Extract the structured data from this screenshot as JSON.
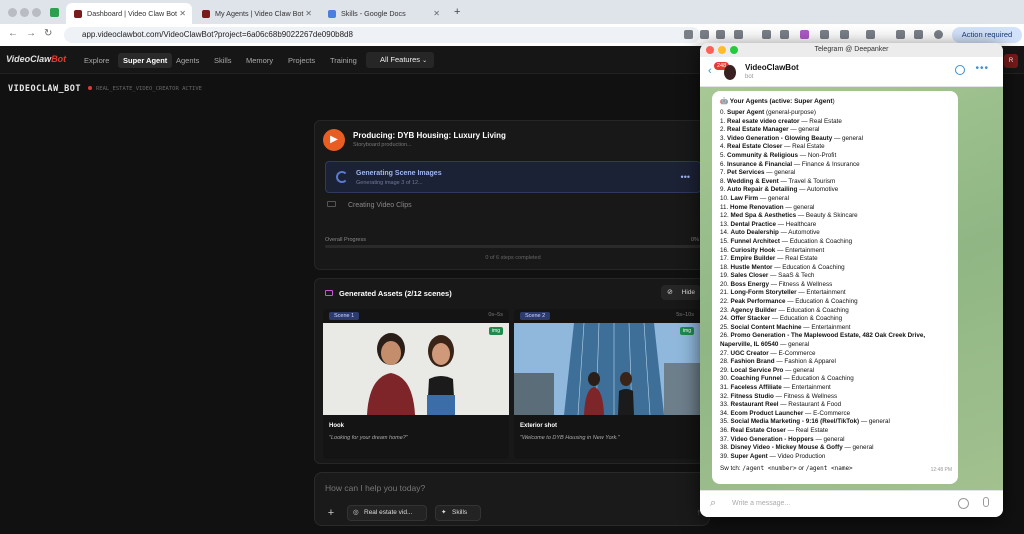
{
  "browser": {
    "tabs": [
      {
        "label": "Dashboard | Video Claw Bot"
      },
      {
        "label": "My Agents | Video Claw Bot"
      },
      {
        "label": "Skills - Google Docs"
      }
    ],
    "new_tab": "+",
    "url": "app.videoclawbot.com/VideoClawBot?project=6a06c68b9022267de090b8d8",
    "action_required": "Action required"
  },
  "app": {
    "logo_main": "VideoClaw",
    "logo_accent": "Bot",
    "nav": [
      "Explore",
      "Super Agent",
      "Agents",
      "Skills",
      "Memory",
      "Projects",
      "Training"
    ],
    "all_features": "All Features",
    "avatar_letter": "R",
    "header_title": "VIDEOCLAW_BOT",
    "header_status": "REAL_ESTATE_VIDEO_CREATOR ACTIVE"
  },
  "production": {
    "title": "Producing: DYB Housing: Luxury Living",
    "subtitle": "Storyboard production...",
    "step1_title": "Generating Scene Images",
    "step1_sub": "Generating image 3 of 12...",
    "step2_title": "Creating Video Clips",
    "overall_label": "Overall Progress",
    "overall_pct": "0%",
    "overall_progress": 0,
    "steps_completed": "0 of 6 steps completed"
  },
  "assets": {
    "title": "Generated Assets (2/12 scenes)",
    "hide_label": "Hide",
    "scenes": [
      {
        "badge": "Scene 1",
        "time": "0s–5s",
        "tag": "img",
        "caption": "Hook",
        "quote": "\"Looking for your dream home?\""
      },
      {
        "badge": "Scene 2",
        "time": "5s–10s",
        "tag": "img",
        "caption": "Exterior shot",
        "quote": "\"Welcome to DYB Housing in New York.\""
      }
    ]
  },
  "chat": {
    "placeholder": "How can I help you today?",
    "agent_chip": "Real estate vid...",
    "skills_chip": "Skills"
  },
  "telegram": {
    "window_title": "Telegram @ Deepanker",
    "unread": "248",
    "bot_name": "VideoClawBot",
    "bot_sub": "bot",
    "header_prefix": "Your Agents (active: ",
    "header_active": "Super Agent",
    "header_suffix": ")",
    "agents": [
      {
        "n": "0.",
        "name": "Super Agent",
        "cat": "(general-purpose)"
      },
      {
        "n": "1.",
        "name": "Real esate video creator",
        "cat": "— Real Estate"
      },
      {
        "n": "2.",
        "name": "Real Estate Manager",
        "cat": "— general"
      },
      {
        "n": "3.",
        "name": "Video Generation - Glowing Beauty",
        "cat": "— general"
      },
      {
        "n": "4.",
        "name": "Real Estate Closer",
        "cat": "— Real Estate"
      },
      {
        "n": "5.",
        "name": "Community & Religious",
        "cat": "— Non-Profit"
      },
      {
        "n": "6.",
        "name": "Insurance & Financial",
        "cat": "— Finance & Insurance"
      },
      {
        "n": "7.",
        "name": "Pet Services",
        "cat": "— general"
      },
      {
        "n": "8.",
        "name": "Wedding & Event",
        "cat": "— Travel & Tourism"
      },
      {
        "n": "9.",
        "name": "Auto Repair & Detailing",
        "cat": "— Automotive"
      },
      {
        "n": "10.",
        "name": "Law Firm",
        "cat": "— general"
      },
      {
        "n": "11.",
        "name": "Home Renovation",
        "cat": "— general"
      },
      {
        "n": "12.",
        "name": "Med Spa & Aesthetics",
        "cat": "— Beauty & Skincare"
      },
      {
        "n": "13.",
        "name": "Dental Practice",
        "cat": "— Healthcare"
      },
      {
        "n": "14.",
        "name": "Auto Dealership",
        "cat": "— Automotive"
      },
      {
        "n": "15.",
        "name": "Funnel Architect",
        "cat": "— Education & Coaching"
      },
      {
        "n": "16.",
        "name": "Curiosity Hook",
        "cat": "— Entertainment"
      },
      {
        "n": "17.",
        "name": "Empire Builder",
        "cat": "— Real Estate"
      },
      {
        "n": "18.",
        "name": "Hustle Mentor",
        "cat": "— Education & Coaching"
      },
      {
        "n": "19.",
        "name": "Sales Closer",
        "cat": "— SaaS & Tech"
      },
      {
        "n": "20.",
        "name": "Boss Energy",
        "cat": "— Fitness & Wellness"
      },
      {
        "n": "21.",
        "name": "Long-Form Storyteller",
        "cat": "— Entertainment"
      },
      {
        "n": "22.",
        "name": "Peak Performance",
        "cat": "— Education & Coaching"
      },
      {
        "n": "23.",
        "name": "Agency Builder",
        "cat": "— Education & Coaching"
      },
      {
        "n": "24.",
        "name": "Offer Stacker",
        "cat": "— Education & Coaching"
      },
      {
        "n": "25.",
        "name": "Social Content Machine",
        "cat": "— Entertainment"
      },
      {
        "n": "26.",
        "name": "Promo Generation - The Maplewood Estate, 482 Oak Creek Drive, Naperville, IL 60540",
        "cat": "— general"
      },
      {
        "n": "27.",
        "name": "UGC Creator",
        "cat": "— E-Commerce"
      },
      {
        "n": "28.",
        "name": "Fashion Brand",
        "cat": "— Fashion & Apparel"
      },
      {
        "n": "29.",
        "name": "Local Service Pro",
        "cat": "— general"
      },
      {
        "n": "30.",
        "name": "Coaching Funnel",
        "cat": "— Education & Coaching"
      },
      {
        "n": "31.",
        "name": "Faceless Affiliate",
        "cat": "— Entertainment"
      },
      {
        "n": "32.",
        "name": "Fitness Studio",
        "cat": "— Fitness & Wellness"
      },
      {
        "n": "33.",
        "name": "Restaurant Reel",
        "cat": "— Restaurant & Food"
      },
      {
        "n": "34.",
        "name": "Ecom Product Launcher",
        "cat": "— E-Commerce"
      },
      {
        "n": "35.",
        "name": "Social Media Marketing - 9:16 (Reel/TikTok)",
        "cat": "— general"
      },
      {
        "n": "36.",
        "name": "Real Estate Closer",
        "cat": "— Real Estate"
      },
      {
        "n": "37.",
        "name": "Video Generation - Hoppers",
        "cat": "— general"
      },
      {
        "n": "38.",
        "name": "Disney Video - Mickey Mouse & Goffy",
        "cat": "— general"
      },
      {
        "n": "39.",
        "name": "Super Agent",
        "cat": "— Video Production"
      }
    ],
    "switch_prefix": "Sw tch: ",
    "switch_cmd1": "/agent <number>",
    "switch_or": " or ",
    "switch_cmd2": "/agent <name>",
    "time": "12:48 PM",
    "input_placeholder": "Write a message..."
  },
  "colors": {
    "accent_red": "#e53935",
    "tg_blue": "#3a8fd6",
    "progress_blue": "#5a7ad0"
  }
}
